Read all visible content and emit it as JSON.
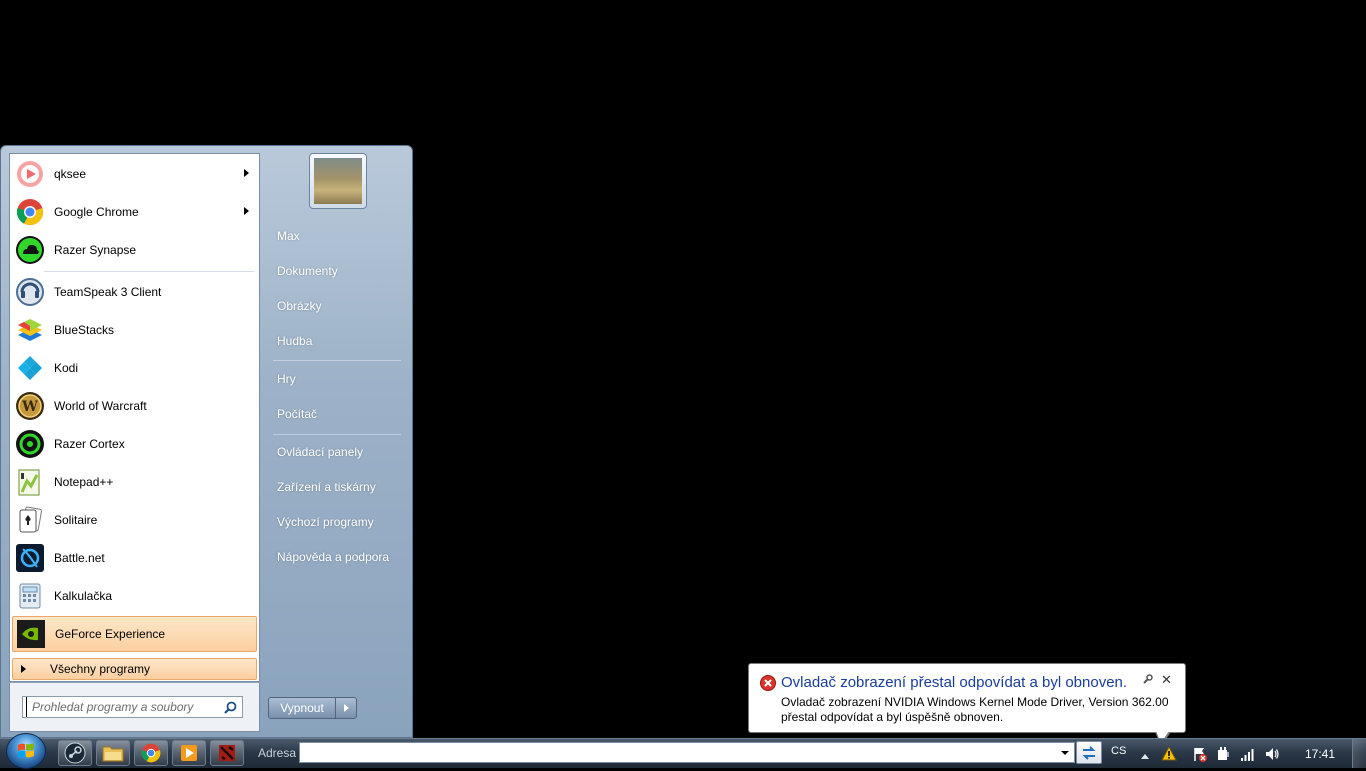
{
  "start_menu": {
    "pinned": [
      {
        "label": "qksee",
        "icon": "qksee-icon"
      },
      {
        "label": "Google Chrome",
        "icon": "chrome-icon"
      },
      {
        "label": "Razer Synapse",
        "icon": "razer-synapse-icon"
      }
    ],
    "recent": [
      {
        "label": "TeamSpeak 3 Client",
        "icon": "teamspeak-icon"
      },
      {
        "label": "BlueStacks",
        "icon": "bluestacks-icon"
      },
      {
        "label": "Kodi",
        "icon": "kodi-icon"
      },
      {
        "label": "World of Warcraft",
        "icon": "wow-icon"
      },
      {
        "label": "Razer Cortex",
        "icon": "razer-cortex-icon"
      },
      {
        "label": "Notepad++",
        "icon": "notepadpp-icon"
      },
      {
        "label": "Solitaire",
        "icon": "solitaire-icon"
      },
      {
        "label": "Battle.net",
        "icon": "battlenet-icon"
      },
      {
        "label": "Kalkulačka",
        "icon": "calculator-icon"
      },
      {
        "label": "GeForce Experience",
        "icon": "geforce-icon"
      }
    ],
    "all_programs": "Všechny programy",
    "search_placeholder": "Prohledat programy a soubory",
    "right_links": {
      "user": "Max",
      "documents": "Dokumenty",
      "pictures": "Obrázky",
      "music": "Hudba",
      "games": "Hry",
      "computer": "Počítač",
      "control_panel": "Ovládací panely",
      "devices": "Zařízení a tiskárny",
      "default_programs": "Výchozí programy",
      "help": "Nápověda a podpora"
    },
    "shutdown": "Vypnout"
  },
  "notification": {
    "title": "Ovladač zobrazení přestal odpovídat a byl obnoven.",
    "line1": "Ovladač zobrazení NVIDIA Windows Kernel Mode Driver, Version 362.00",
    "line2": "přestal odpovídat a byl úspěšně obnoven."
  },
  "taskbar": {
    "address_label": "Adresa",
    "address_value": "",
    "language": "CS",
    "clock": "17:41",
    "pinned": [
      "steam-icon",
      "explorer-icon",
      "chrome-icon",
      "media-player-icon",
      "dota-icon"
    ]
  },
  "colors": {
    "start_menu_bg": "#9db2c8",
    "highlight": "#fbcfa0",
    "notification_title": "#1a3d9c",
    "taskbar": "#2b3848"
  }
}
